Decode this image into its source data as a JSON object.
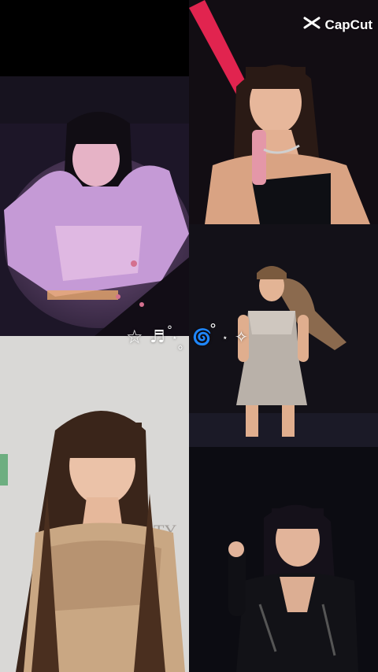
{
  "watermark": {
    "brand": "CapCut",
    "icon": "capcut-logo-icon"
  },
  "decoration": {
    "glyphs": [
      "☆",
      "♬",
      "°",
      "⋆",
      "｡",
      "🌀",
      "°",
      "⋆",
      "✧"
    ]
  },
  "photos": [
    {
      "id": "stage-heart-hands",
      "tone": "purple stage light"
    },
    {
      "id": "microphone-smile",
      "tone": "dark with red light"
    },
    {
      "id": "sparkle-outfit-stage",
      "tone": "dark stage"
    },
    {
      "id": "event-backdrop-smile",
      "backdrop_text": "TY"
    },
    {
      "id": "black-outfit-headset",
      "tone": "dark stage"
    }
  ]
}
